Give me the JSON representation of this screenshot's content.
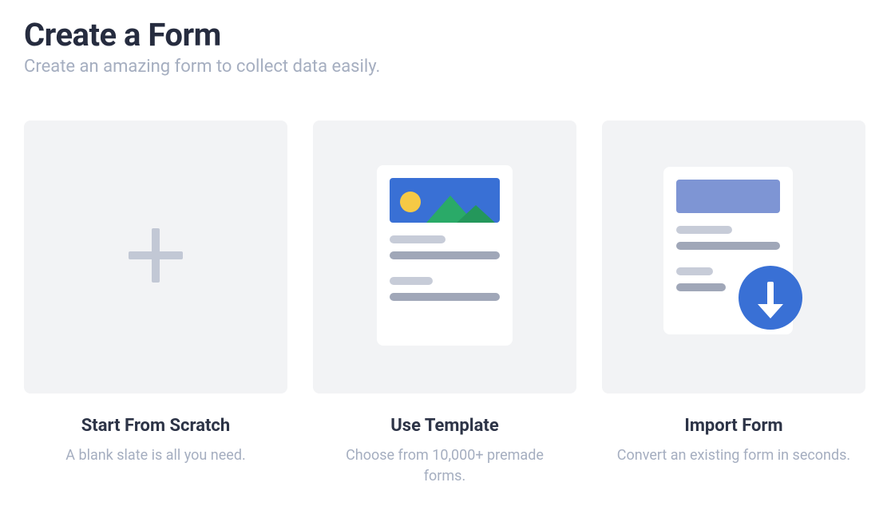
{
  "header": {
    "title": "Create a Form",
    "subtitle": "Create an amazing form to collect data easily."
  },
  "options": {
    "scratch": {
      "title": "Start From Scratch",
      "description": "A blank slate is all you need."
    },
    "template": {
      "title": "Use Template",
      "description": "Choose from 10,000+ premade forms."
    },
    "import": {
      "title": "Import Form",
      "description": "Convert an existing form in seconds."
    }
  }
}
